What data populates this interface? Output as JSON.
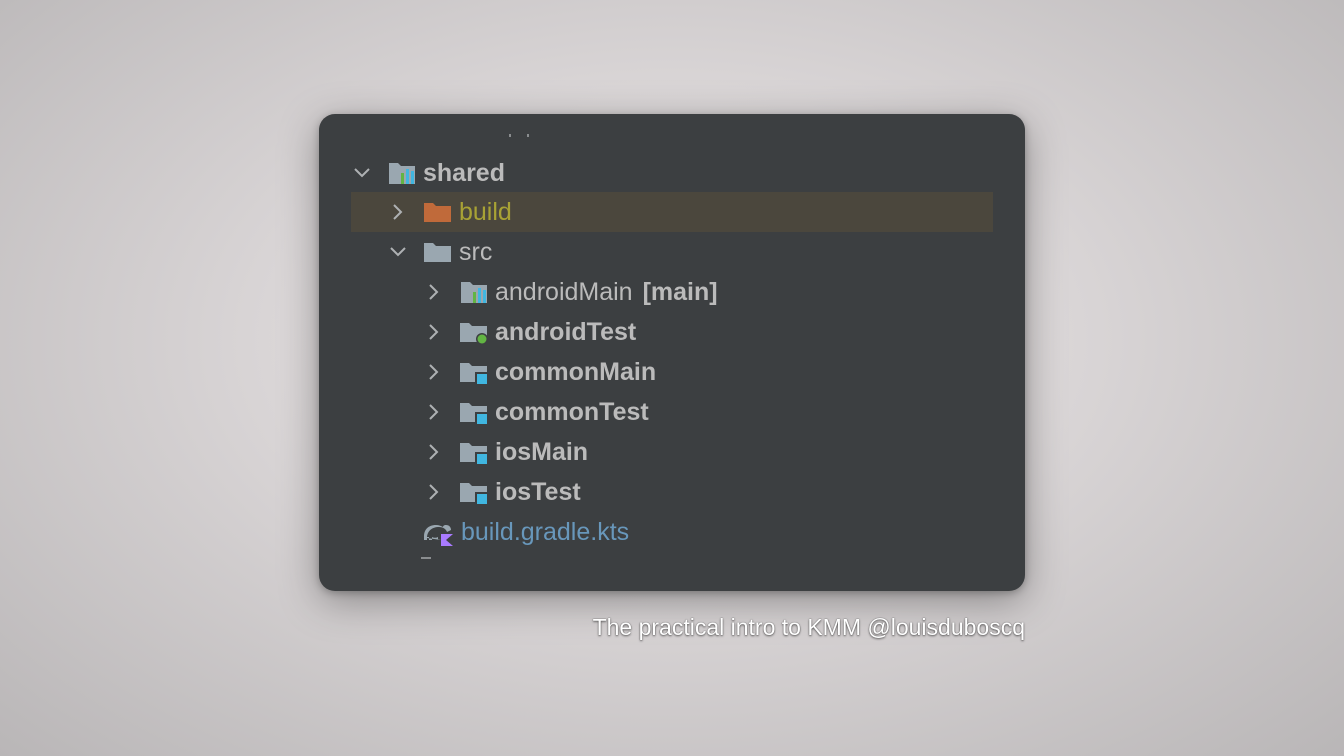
{
  "tree": {
    "root": {
      "label": "shared",
      "icon": "module-folder-icon",
      "expanded": true
    },
    "items": [
      {
        "label": "build",
        "icon": "excluded-folder-icon",
        "expanded": false,
        "selected": true
      },
      {
        "label": "src",
        "icon": "folder-icon",
        "expanded": true
      },
      {
        "label": "androidMain",
        "tag": "[main]",
        "icon": "module-folder-icon",
        "expanded": false
      },
      {
        "label": "androidTest",
        "icon": "test-folder-icon",
        "expanded": false
      },
      {
        "label": "commonMain",
        "icon": "source-set-folder-icon",
        "expanded": false
      },
      {
        "label": "commonTest",
        "icon": "source-set-folder-icon",
        "expanded": false
      },
      {
        "label": "iosMain",
        "icon": "source-set-folder-icon",
        "expanded": false
      },
      {
        "label": "iosTest",
        "icon": "source-set-folder-icon",
        "expanded": false
      },
      {
        "label": "build.gradle.kts",
        "icon": "gradle-kotlin-file-icon"
      }
    ]
  },
  "caption": "The practical intro to KMM @louisduboscq",
  "colors": {
    "panel": "#3c3f41",
    "selection": "#4b473d",
    "excluded_text": "#a8a235",
    "file_link": "#6897bb",
    "excluded_folder": "#c06a3a",
    "folder": "#9aa7b0",
    "source_set_badge": "#40b6e0",
    "test_badge": "#62b543"
  }
}
